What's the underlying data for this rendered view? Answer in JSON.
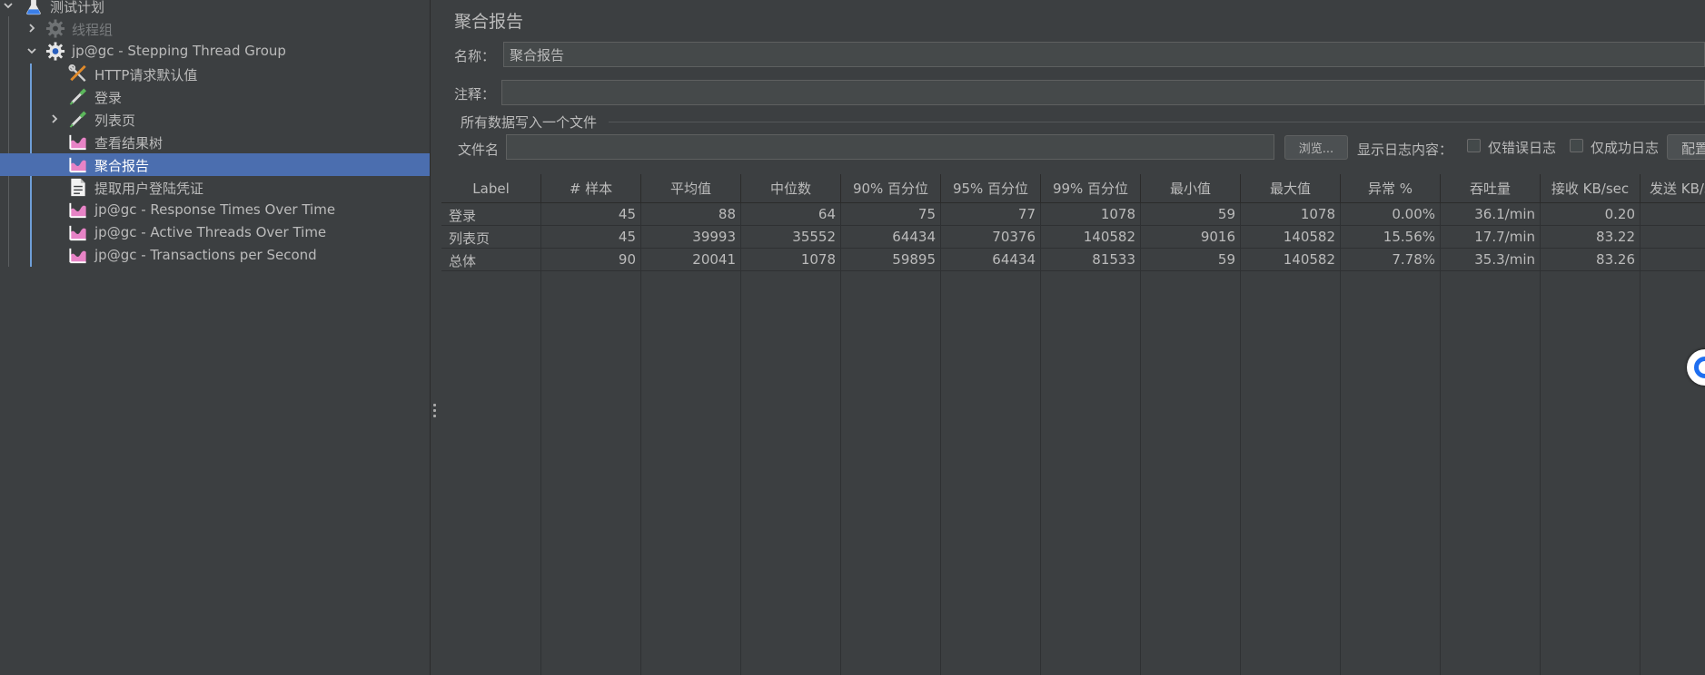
{
  "tree": {
    "nodes": [
      {
        "label": "测试计划",
        "icon": "flask-icon",
        "arrow": "down"
      },
      {
        "label": "线程组",
        "icon": "gear-icon",
        "arrow": "right",
        "disabled": true
      },
      {
        "label": "jp@gc - Stepping Thread Group",
        "icon": "gear-icon",
        "arrow": "down"
      },
      {
        "label": "HTTP请求默认值",
        "icon": "wrench-icon"
      },
      {
        "label": "登录",
        "icon": "pipette-icon"
      },
      {
        "label": "列表页",
        "icon": "pipette-icon",
        "arrow": "right"
      },
      {
        "label": "查看结果树",
        "icon": "graph-icon"
      },
      {
        "label": "聚合报告",
        "icon": "graph-icon",
        "selected": true
      },
      {
        "label": "提取用户登陆凭证",
        "icon": "document-icon"
      },
      {
        "label": "jp@gc - Response Times Over Time",
        "icon": "graph-icon"
      },
      {
        "label": "jp@gc - Active Threads Over Time",
        "icon": "graph-icon"
      },
      {
        "label": "jp@gc - Transactions per Second",
        "icon": "graph-icon"
      }
    ]
  },
  "panel": {
    "title": "聚合报告",
    "name_label": "名称：",
    "name_value": "聚合报告",
    "comment_label": "注释：",
    "comment_value": "",
    "file_group_title": "所有数据写入一个文件",
    "filename_label": "文件名",
    "filename_value": "",
    "browse_button": "浏览...",
    "log_content_label": "显示日志内容：",
    "errors_only_label": "仅错误日志",
    "success_only_label": "仅成功日志",
    "config_button": "配置"
  },
  "table": {
    "headers": [
      "Label",
      "# 样本",
      "平均值",
      "中位数",
      "90% 百分位",
      "95% 百分位",
      "99% 百分位",
      "最小值",
      "最大值",
      "异常 %",
      "吞吐量",
      "接收 KB/sec",
      "发送 KB/sec"
    ],
    "rows": [
      [
        "登录",
        "45",
        "88",
        "64",
        "75",
        "77",
        "1078",
        "59",
        "1078",
        "0.00%",
        "36.1/min",
        "0.20",
        ""
      ],
      [
        "列表页",
        "45",
        "39993",
        "35552",
        "64434",
        "70376",
        "140582",
        "9016",
        "140582",
        "15.56%",
        "17.7/min",
        "83.22",
        ""
      ],
      [
        "总体",
        "90",
        "20041",
        "1078",
        "59895",
        "64434",
        "81533",
        "59",
        "140582",
        "7.78%",
        "35.3/min",
        "83.26",
        ""
      ]
    ]
  },
  "colors": {
    "background": "#3c3f41",
    "selection": "#4b6eaf",
    "text": "#bbbbbb",
    "accent": "#1e6ef0"
  }
}
